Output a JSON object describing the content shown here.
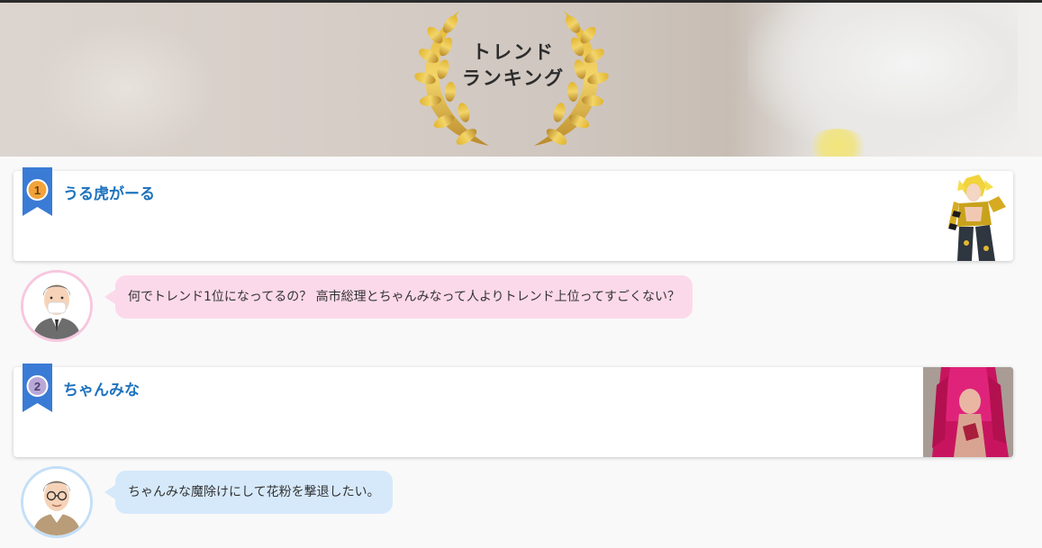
{
  "hero": {
    "title_line1": "トレンド",
    "title_line2": "ランキング"
  },
  "rankings": [
    {
      "rank": "1",
      "name": "うる虎がーる",
      "badge_color": "#f2a33a"
    },
    {
      "rank": "2",
      "name": "ちゃんみな",
      "badge_color": "#b9a7d8"
    }
  ],
  "comments": [
    {
      "text": "何でトレンド1位になってるの？ 高市総理とちゃんみなって人よりトレンド上位ってすごくない？",
      "bubble_color": "#fcd9ea"
    },
    {
      "text": "ちゃんみな魔除けにして花粉を撃退したい。",
      "bubble_color": "#d6e9fb"
    }
  ],
  "colors": {
    "accent": "#1e73be",
    "ribbon": "#3a7bd5"
  }
}
